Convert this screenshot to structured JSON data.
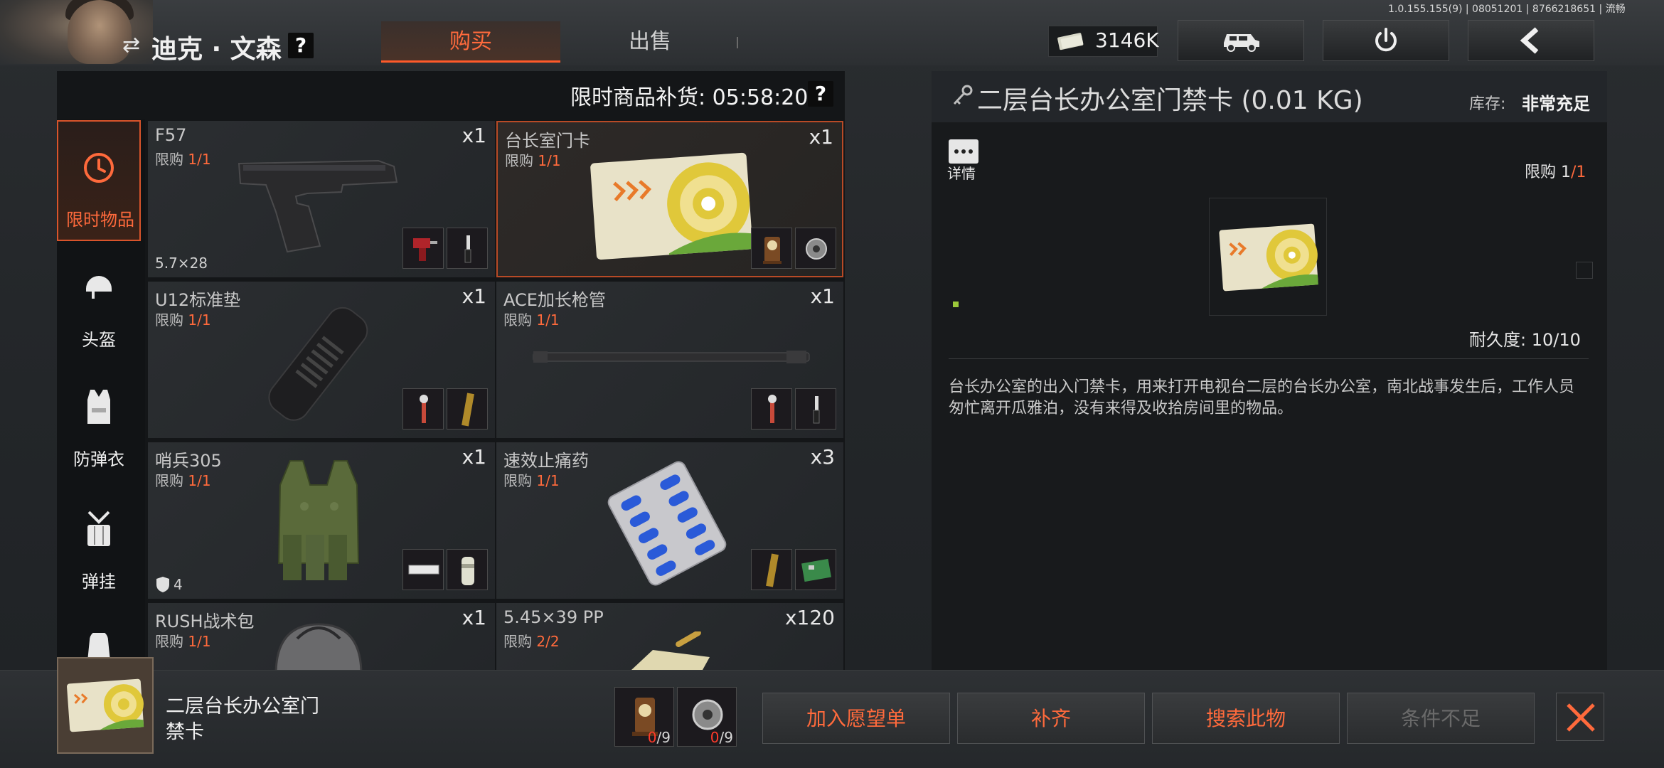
{
  "version": "1.0.155.155(9) | 08051201 | 8766218651 | 流畅",
  "player": {
    "name": "迪克 · 文森",
    "swap_icon": "swap-icon",
    "help": "?"
  },
  "tabs": [
    {
      "label": "购买",
      "active": true
    },
    {
      "label": "出售",
      "active": false
    }
  ],
  "currency": {
    "amount": "3146K",
    "icon": "cash-icon"
  },
  "top_buttons": [
    {
      "icon": "vehicle-icon"
    },
    {
      "icon": "power-icon"
    },
    {
      "icon": "back-icon"
    }
  ],
  "restock": {
    "label": "限时商品补货: 05:58:20",
    "help": "?"
  },
  "categories": [
    {
      "label": "限时物品",
      "icon": "clock-icon",
      "active": true
    },
    {
      "label": "头盔",
      "icon": "helmet-icon"
    },
    {
      "label": "防弹衣",
      "icon": "vest-icon"
    },
    {
      "label": "弹挂",
      "icon": "rig-icon"
    },
    {
      "label": "",
      "icon": "backpack-icon"
    }
  ],
  "items": [
    {
      "name": "F57",
      "limit_prefix": "限购 ",
      "limit": "1/1",
      "qty": "x1",
      "bottom": "5.7×28"
    },
    {
      "name": "台长室门卡",
      "limit_prefix": "限购 ",
      "limit": "1/1",
      "qty": "x1",
      "bottom": ""
    },
    {
      "name": "U12标准垫",
      "limit_prefix": "限购 ",
      "limit": "1/1",
      "qty": "x1",
      "bottom": ""
    },
    {
      "name": "ACE加长枪管",
      "limit_prefix": "限购 ",
      "limit": "1/1",
      "qty": "x1",
      "bottom": ""
    },
    {
      "name": "哨兵305",
      "limit_prefix": "限购 ",
      "limit": "1/1",
      "qty": "x1",
      "bottom": "4"
    },
    {
      "name": "速效止痛药",
      "limit_prefix": "限购 ",
      "limit": "1/1",
      "qty": "x3",
      "bottom": ""
    },
    {
      "name": "RUSH战术包",
      "limit_prefix": "限购 ",
      "limit": "1/1",
      "qty": "x1",
      "bottom": ""
    },
    {
      "name": "5.45×39 PP",
      "limit_prefix": "限购 ",
      "limit": "2/2",
      "qty": "x120",
      "bottom": ""
    }
  ],
  "detail": {
    "title": "二层台长办公室门禁卡 (0.01 KG)",
    "stock_label": "库存:",
    "stock_value": "非常充足",
    "info_label": "详情",
    "limit_prefix": "限购 ",
    "limit_a": "1",
    "limit_b": "/1",
    "durability": "耐久度: 10/10",
    "description": "台长办公室的出入门禁卡，用来打开电视台二层的台长办公室，南北战事发生后，工作人员匆忙离开瓜雅泊，没有来得及收拾房间里的物品。"
  },
  "bottom": {
    "item_name": "二层台长办公室门禁卡",
    "requirements": [
      {
        "icon": "clock-ornament-icon",
        "have": "0",
        "need": "/9"
      },
      {
        "icon": "gear-part-icon",
        "have": "0",
        "need": "/9"
      }
    ],
    "buttons": [
      {
        "label": "加入愿望单",
        "enabled": true
      },
      {
        "label": "补齐",
        "enabled": true
      },
      {
        "label": "搜索此物",
        "enabled": true
      },
      {
        "label": "条件不足",
        "enabled": false
      }
    ]
  },
  "colors": {
    "accent": "#ff6a3c",
    "panel": "#141618",
    "selected_border": "#b84a26"
  }
}
